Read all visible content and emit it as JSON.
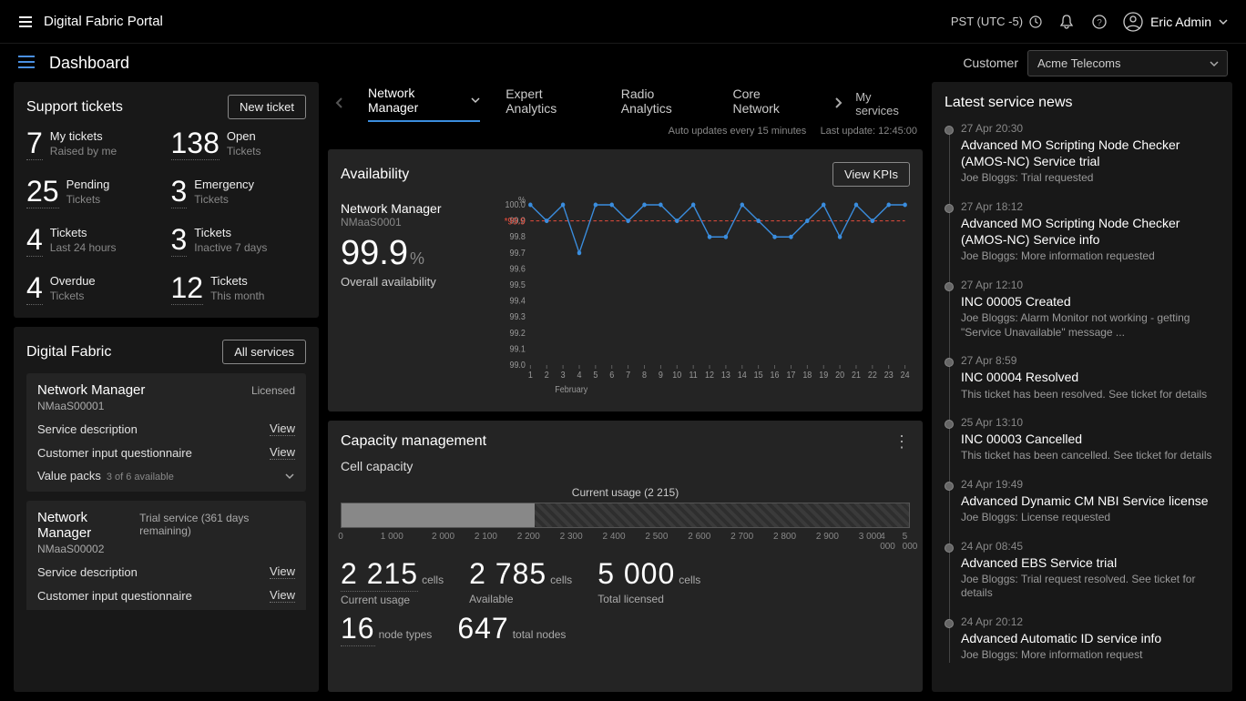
{
  "brand": "Digital Fabric Portal",
  "timezone": "PST (UTC -5)",
  "user_name": "Eric Admin",
  "page_title": "Dashboard",
  "customer_label": "Customer",
  "customer_selected": "Acme Telecoms",
  "support": {
    "title": "Support tickets",
    "new_btn": "New ticket",
    "items": [
      {
        "num": "7",
        "l1": "My tickets",
        "l2": "Raised by me"
      },
      {
        "num": "138",
        "l1": "Open",
        "l2": "Tickets"
      },
      {
        "num": "25",
        "l1": "Pending",
        "l2": "Tickets"
      },
      {
        "num": "3",
        "l1": "Emergency",
        "l2": "Tickets"
      },
      {
        "num": "4",
        "l1": "Tickets",
        "l2": "Last 24 hours"
      },
      {
        "num": "3",
        "l1": "Tickets",
        "l2": "Inactive 7 days"
      },
      {
        "num": "4",
        "l1": "Overdue",
        "l2": "Tickets"
      },
      {
        "num": "12",
        "l1": "Tickets",
        "l2": "This month"
      }
    ]
  },
  "digital_fabric": {
    "title": "Digital Fabric",
    "all_btn": "All services",
    "services": [
      {
        "name": "Network Manager",
        "id": "NMaaS00001",
        "status": "Licensed",
        "rows": [
          {
            "label": "Service description",
            "action": "View"
          },
          {
            "label": "Customer input questionnaire",
            "action": "View"
          }
        ],
        "vp_label": "Value packs",
        "vp_meta": "3 of 6 available"
      },
      {
        "name": "Network Manager",
        "id": "NMaaS00002",
        "status": "Trial service (361 days remaining)",
        "rows": [
          {
            "label": "Service description",
            "action": "View"
          },
          {
            "label": "Customer input questionnaire",
            "action": "View"
          }
        ]
      }
    ]
  },
  "tabs": {
    "items": [
      "Network Manager",
      "Expert Analytics",
      "Radio Analytics",
      "Core Network"
    ],
    "my_services": "My services",
    "auto_update": "Auto updates every 15 minutes",
    "last_update": "Last update: 12:45:00"
  },
  "availability": {
    "title": "Availability",
    "view_kpis": "View KPIs",
    "service": "Network Manager",
    "service_id": "NMaaS0001",
    "pct": "99.9",
    "pct_sym": "%",
    "overall_label": "Overall availability",
    "month_label": "February",
    "target_label": "*99.9"
  },
  "chart_data": {
    "type": "line",
    "title": "Availability",
    "xlabel": "February",
    "ylabel": "%",
    "ylim": [
      99.0,
      100.0
    ],
    "yticks": [
      100.0,
      99.9,
      99.8,
      99.7,
      99.6,
      99.5,
      99.4,
      99.3,
      99.2,
      99.1,
      99.0
    ],
    "x": [
      1,
      2,
      3,
      4,
      5,
      6,
      7,
      8,
      9,
      10,
      11,
      12,
      13,
      14,
      15,
      16,
      17,
      18,
      19,
      20,
      21,
      22,
      23,
      24
    ],
    "series": [
      {
        "name": "Overall availability",
        "values": [
          100.0,
          99.9,
          100.0,
          99.7,
          100.0,
          100.0,
          99.9,
          100.0,
          100.0,
          99.9,
          100.0,
          99.8,
          99.8,
          100.0,
          99.9,
          99.8,
          99.8,
          99.9,
          100.0,
          99.8,
          100.0,
          99.9,
          100.0,
          100.0
        ]
      }
    ],
    "target": 99.9
  },
  "capacity": {
    "title": "Capacity management",
    "subtitle": "Cell capacity",
    "usage_label": "Current usage (2 215)",
    "axis": [
      "0",
      "1 000",
      "2 000",
      "2 100",
      "2 200",
      "2 300",
      "2 400",
      "2 500",
      "2 600",
      "2 700",
      "2 800",
      "2 900",
      "3 000",
      "4 000",
      "5 000"
    ],
    "stats": [
      {
        "num": "2 215",
        "unit": "cells",
        "sub": "Current  usage",
        "bd": true
      },
      {
        "num": "2 785",
        "unit": "cells",
        "sub": "Available",
        "bd": false
      },
      {
        "num": "5 000",
        "unit": "cells",
        "sub": "Total licensed",
        "bd": false
      }
    ],
    "stats2": [
      {
        "num": "16",
        "unit": "node types",
        "bd": true
      },
      {
        "num": "647",
        "unit": "total nodes",
        "bd": false
      }
    ]
  },
  "news": {
    "title": "Latest service news",
    "items": [
      {
        "ts": "27 Apr 20:30",
        "head": "Advanced MO Scripting Node Checker (AMOS-NC) Service trial",
        "desc": "Joe Bloggs: Trial requested"
      },
      {
        "ts": "27 Apr 18:12",
        "head": "Advanced MO Scripting Node Checker (AMOS-NC) Service info",
        "desc": "Joe Bloggs: More information requested"
      },
      {
        "ts": "27 Apr 12:10",
        "head": "INC 00005 Created",
        "desc": "Joe Bloggs: Alarm Monitor not working - getting \"Service Unavailable\" message ..."
      },
      {
        "ts": "27 Apr 8:59",
        "head": "INC 00004 Resolved",
        "desc": "This ticket has been resolved. See ticket for details"
      },
      {
        "ts": "25 Apr 13:10",
        "head": "INC 00003 Cancelled",
        "desc": "This ticket has been cancelled. See ticket for details"
      },
      {
        "ts": "24 Apr 19:49",
        "head": "Advanced Dynamic CM NBI Service license",
        "desc": "Joe Bloggs: License requested"
      },
      {
        "ts": "24 Apr 08:45",
        "head": "Advanced EBS Service trial",
        "desc": "Joe Bloggs: Trial request resolved. See ticket for details"
      },
      {
        "ts": "24 Apr 20:12",
        "head": "Advanced Automatic ID service info",
        "desc": "Joe Bloggs: More information request"
      }
    ]
  }
}
